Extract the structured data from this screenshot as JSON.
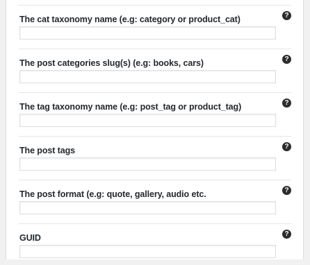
{
  "fields": [
    {
      "label": "The cat taxonomy name (e.g: category or product_cat)",
      "value": "",
      "help": "?"
    },
    {
      "label": "The post categories slug(s) (e.g: books, cars)",
      "value": "",
      "help": "?"
    },
    {
      "label": "The tag taxonomy name (e.g: post_tag or product_tag)",
      "value": "",
      "help": "?"
    },
    {
      "label": "The post tags",
      "value": "",
      "help": "?"
    },
    {
      "label": "The post format (e.g: quote, gallery, audio etc.",
      "value": "",
      "help": "?"
    },
    {
      "label": "GUID",
      "value": "",
      "help": "?"
    }
  ]
}
